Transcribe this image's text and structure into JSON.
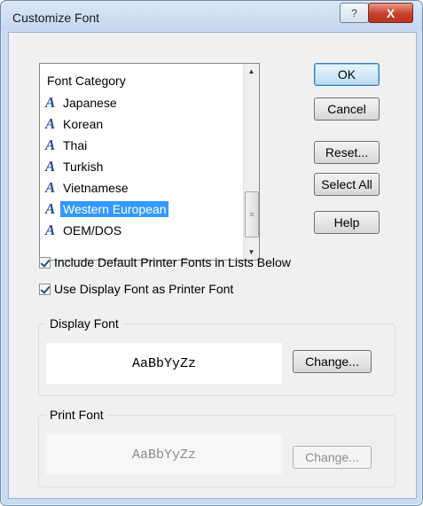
{
  "window": {
    "title": "Customize Font",
    "help_symbol": "?",
    "close_symbol": "X"
  },
  "font_list": {
    "header": "Font Category",
    "items": [
      {
        "label": "Japanese",
        "icon": "font-A-icon",
        "selected": false
      },
      {
        "label": "Korean",
        "icon": "font-A-icon",
        "selected": false
      },
      {
        "label": "Thai",
        "icon": "font-A-icon",
        "selected": false
      },
      {
        "label": "Turkish",
        "icon": "font-A-icon",
        "selected": false
      },
      {
        "label": "Vietnamese",
        "icon": "font-A-icon",
        "selected": false
      },
      {
        "label": "Western European",
        "icon": "font-A-icon",
        "selected": true
      },
      {
        "label": "OEM/DOS",
        "icon": "font-A-icon",
        "selected": false
      }
    ],
    "icon_glyph": "A",
    "scroll_up": "▲",
    "scroll_down": "▼",
    "thumb_grip": "≡"
  },
  "buttons": {
    "ok": "OK",
    "cancel": "Cancel",
    "reset": "Reset...",
    "select_all": "Select All",
    "help": "Help"
  },
  "options": {
    "include_printer_fonts": "Include Default Printer Fonts in Lists Below",
    "use_display_font": "Use Display Font as Printer Font"
  },
  "display_font": {
    "label": "Display Font",
    "sample": "AaBbYyZz",
    "change": "Change..."
  },
  "print_font": {
    "label": "Print Font",
    "sample": "AaBbYyZz",
    "change": "Change..."
  },
  "colors": {
    "selection": "#3399ff",
    "title_bar": "#c9dcf2",
    "close_button": "#c6402a"
  }
}
